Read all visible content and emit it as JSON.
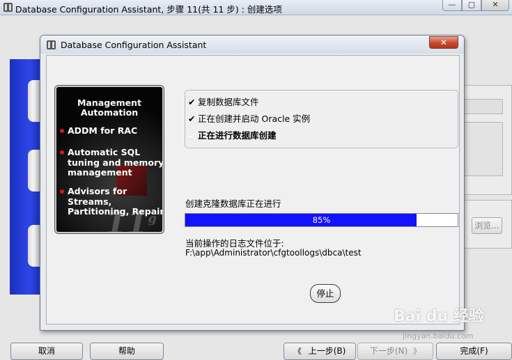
{
  "outer_window": {
    "title": "Database Configuration Assistant, 步骤 11(共 11 步) : 创建选项",
    "controls": {
      "minimize": "—",
      "maximize": "▢",
      "close": "✕"
    },
    "browse_label": "浏览...",
    "buttons": {
      "cancel": "取消",
      "help": "帮助",
      "back": "上一步(B)",
      "next": "下一步(N)",
      "finish": "完成(F)"
    }
  },
  "dialog": {
    "title": "Database Configuration Assistant",
    "close_glyph": "✕",
    "feature_panel": {
      "heading_line1": "Management",
      "heading_line2": "Automation",
      "items": [
        {
          "lines": [
            "ADDM for RAC"
          ]
        },
        {
          "lines": [
            "Automatic SQL",
            "tuning and memory",
            "management"
          ]
        },
        {
          "lines": [
            "Advisors for",
            "Streams,",
            "Partitioning, Repair"
          ]
        }
      ]
    },
    "steps": [
      {
        "check": "✔",
        "label": "复制数据库文件",
        "state": "done"
      },
      {
        "check": "✔",
        "label": "正在创建并启动 Oracle 实例",
        "state": "done"
      },
      {
        "check": "✔",
        "label": "正在进行数据库创建",
        "state": "active"
      }
    ],
    "progress": {
      "label": "创建克隆数据库正在进行",
      "value": 0.85,
      "text": "85%"
    },
    "log": {
      "label": "当前操作的日志文件位于:",
      "path": "F:\\app\\Administrator\\cfgtoollogs\\dbca\\test"
    },
    "stop_label": "停止"
  },
  "watermark": {
    "brand": "Bai du 经验",
    "url": "jingyan.baidu.com"
  },
  "colors": {
    "progress_fill": "#1212ff",
    "close_button": "#c8472d",
    "bullet": "#e01515"
  }
}
